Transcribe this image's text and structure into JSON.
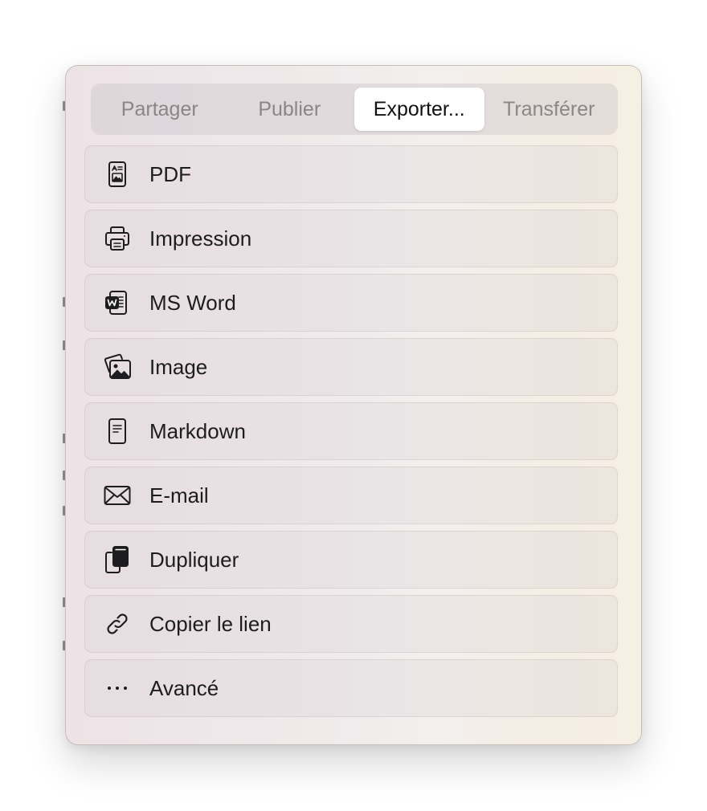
{
  "tabs": [
    {
      "label": "Partager",
      "active": false
    },
    {
      "label": "Publier",
      "active": false
    },
    {
      "label": "Exporter...",
      "active": true
    },
    {
      "label": "Transférer",
      "active": false
    }
  ],
  "items": [
    {
      "label": "PDF",
      "icon": "pdf-icon"
    },
    {
      "label": "Impression",
      "icon": "printer-icon"
    },
    {
      "label": "MS Word",
      "icon": "ms-word-icon"
    },
    {
      "label": "Image",
      "icon": "photos-icon"
    },
    {
      "label": "Markdown",
      "icon": "document-icon"
    },
    {
      "label": "E-mail",
      "icon": "envelope-icon"
    },
    {
      "label": "Dupliquer",
      "icon": "duplicate-icon"
    },
    {
      "label": "Copier le lien",
      "icon": "link-icon"
    },
    {
      "label": "Avancé",
      "icon": "ellipsis-icon"
    }
  ],
  "colors": {
    "active_tab_bg": "#ffffff",
    "inactive_tab_text": "#8a8688",
    "item_text": "#1d1d1f"
  }
}
